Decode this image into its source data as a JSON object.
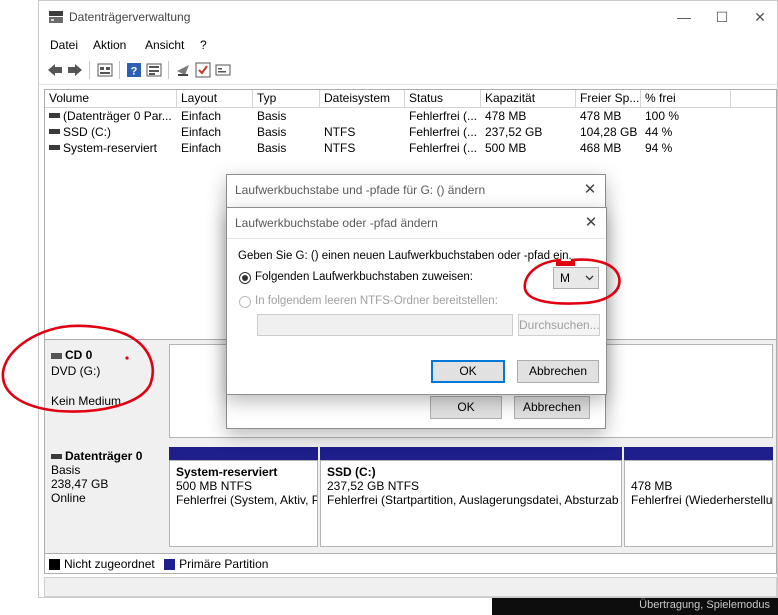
{
  "window": {
    "title": "Datenträgerverwaltung",
    "controls": {
      "minimize": "—",
      "maximize": "☐",
      "close": "✕"
    }
  },
  "menu": [
    "Datei",
    "Aktion",
    "Ansicht",
    "?"
  ],
  "toolbar": {
    "icons": [
      "back-arrow-icon",
      "forward-arrow-icon",
      "properties-icon",
      "help-icon",
      "disk-list-icon",
      "connect-icon",
      "check-icon",
      "settings-icon"
    ]
  },
  "volume_table": {
    "columns": [
      "Volume",
      "Layout",
      "Typ",
      "Dateisystem",
      "Status",
      "Kapazität",
      "Freier Sp...",
      "% frei"
    ],
    "rows": [
      [
        "(Datenträger 0 Par...",
        "Einfach",
        "Basis",
        "",
        "Fehlerfrei (...",
        "478 MB",
        "478 MB",
        "100 %"
      ],
      [
        "SSD (C:)",
        "Einfach",
        "Basis",
        "NTFS",
        "Fehlerfrei (...",
        "237,52 GB",
        "104,28 GB",
        "44 %"
      ],
      [
        "System-reserviert",
        "Einfach",
        "Basis",
        "NTFS",
        "Fehlerfrei (...",
        "500 MB",
        "468 MB",
        "94 %"
      ]
    ]
  },
  "cd_disk": {
    "name": "CD 0",
    "type": "DVD (G:)",
    "status": "Kein Medium"
  },
  "disk0": {
    "name": "Datenträger 0",
    "type": "Basis",
    "size": "238,47 GB",
    "status": "Online",
    "partitions": [
      {
        "title": "System-reserviert",
        "size": "500 MB NTFS",
        "status": "Fehlerfrei (System, Aktiv, P"
      },
      {
        "title": "SSD  (C:)",
        "size": "237,52 GB NTFS",
        "status": "Fehlerfrei (Startpartition, Auslagerungsdatei, Absturzab"
      },
      {
        "title": "",
        "size": "478 MB",
        "status": "Fehlerfrei (Wiederherstellu"
      }
    ]
  },
  "legend": [
    {
      "label": "Nicht zugeordnet",
      "color": "#000000"
    },
    {
      "label": "Primäre Partition",
      "color": "#1e1e8c"
    }
  ],
  "outer_dialog": {
    "title": "Laufwerkbuchstabe und -pfade für G: () ändern",
    "ok": "OK",
    "cancel": "Abbrechen"
  },
  "inner_dialog": {
    "title": "Laufwerkbuchstabe oder -pfad ändern",
    "prompt": "Geben Sie G: () einen neuen Laufwerkbuchstaben oder -pfad ein.",
    "option_assign": "Folgenden Laufwerkbuchstaben zuweisen:",
    "selected_letter": "M",
    "option_mount": "In folgendem leeren NTFS-Ordner bereitstellen:",
    "path_value": "",
    "browse": "Durchsuchen...",
    "ok": "OK",
    "cancel": "Abbrechen"
  },
  "background_status": "Übertragung, Spielemodus",
  "colors": {
    "annotation": "#e00012",
    "partition_bar": "#1e1e8c",
    "accent": "#0078d7"
  }
}
